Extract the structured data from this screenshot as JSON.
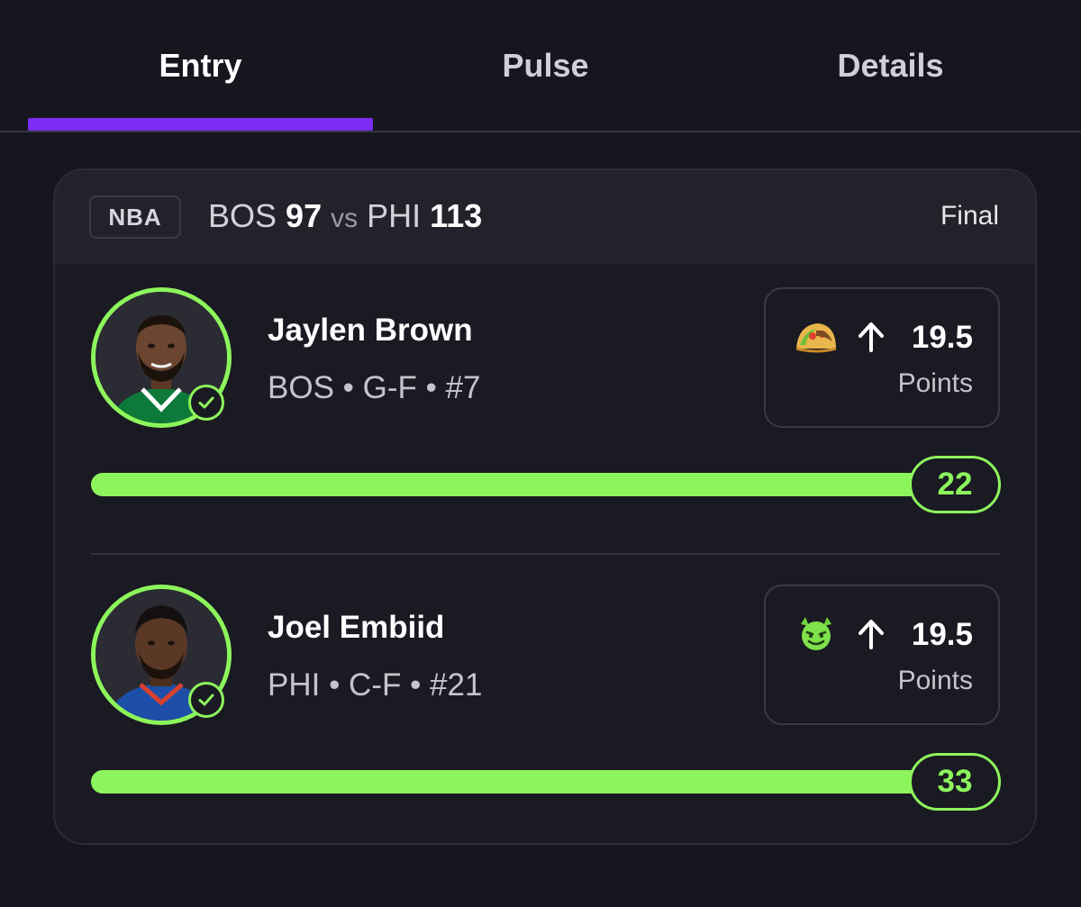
{
  "tabs": [
    {
      "label": "Entry",
      "active": true
    },
    {
      "label": "Pulse",
      "active": false
    },
    {
      "label": "Details",
      "active": false
    }
  ],
  "game": {
    "league": "NBA",
    "away_team": "BOS",
    "away_score": "97",
    "vs": "vs",
    "home_team": "PHI",
    "home_score": "113",
    "status": "Final"
  },
  "players": [
    {
      "name": "Jaylen Brown",
      "meta": "BOS • G-F • #7",
      "pick_icon": "taco-emoji-icon",
      "direction_icon": "arrow-up-icon",
      "line": "19.5",
      "stat": "Points",
      "result": "22",
      "progress_fraction": 1.0,
      "jersey_color": "#0e7a3a",
      "status_icon": "check-circle-icon"
    },
    {
      "name": "Joel Embiid",
      "meta": "PHI • C-F • #21",
      "pick_icon": "smiling-imp-emoji-icon",
      "direction_icon": "arrow-up-icon",
      "line": "19.5",
      "stat": "Points",
      "result": "33",
      "progress_fraction": 1.0,
      "jersey_color": "#1d4fa8",
      "status_icon": "check-circle-icon"
    }
  ],
  "colors": {
    "accent_purple": "#7b2cf5",
    "hit_green": "#8df55c",
    "background": "#16161f",
    "card": "#1a1a23"
  }
}
